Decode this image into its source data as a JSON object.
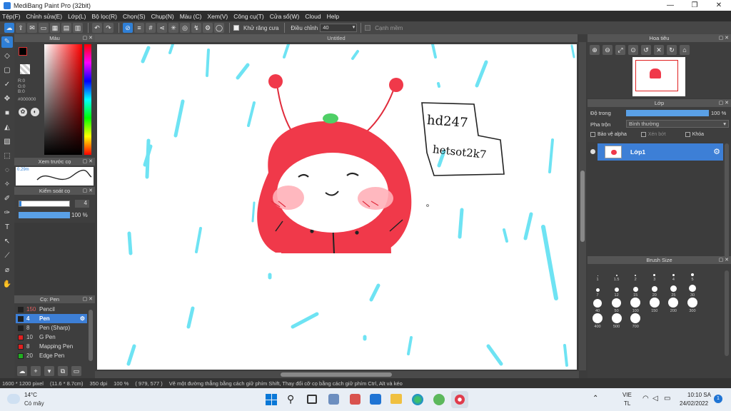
{
  "window": {
    "title": "MediBang Paint Pro (32bit)",
    "minimize": "—",
    "maximize": "❐",
    "close": "✕"
  },
  "menu": [
    "Tệp(F)",
    "Chỉnh sửa(E)",
    "Lớp(L)",
    "Bộ lọc(R)",
    "Chọn(S)",
    "Chụp(N)",
    "Màu (C)",
    "Xem(V)",
    "Công cụ(T)",
    "Cửa sổ(W)",
    "Cloud",
    "Help"
  ],
  "toolbar": {
    "antialias_label": "Khử răng cưa",
    "adjust_label": "Điều chỉnh",
    "adjust_value": "40",
    "smooth_label": "Cạnh mềm"
  },
  "color_panel": {
    "title": "Màu",
    "r": "R:0",
    "g": "G:0",
    "b": "B:0",
    "hex": "#000000"
  },
  "brush_preview": {
    "title": "Xem trước cọ",
    "size": "0.29m"
  },
  "brush_control": {
    "title": "Kiểm soát cọ",
    "size_value": "4",
    "opacity_value": "100 %"
  },
  "brush_list": {
    "title": "Cọ: Pen",
    "items": [
      {
        "size": "150",
        "name": "Pencil",
        "color": "#202020",
        "selected": false
      },
      {
        "size": "4",
        "name": "Pen",
        "color": "#202020",
        "selected": true
      },
      {
        "size": "8",
        "name": "Pen (Sharp)",
        "color": "#202020",
        "selected": false
      },
      {
        "size": "10",
        "name": "G Pen",
        "color": "#e02020",
        "selected": false
      },
      {
        "size": "8",
        "name": "Mapping Pen",
        "color": "#e02020",
        "selected": false
      },
      {
        "size": "20",
        "name": "Edge Pen",
        "color": "#20b020",
        "selected": false
      }
    ]
  },
  "document": {
    "tab": "Untitled"
  },
  "canvas_text": {
    "line1": "hd247",
    "line2": "hetsot2k7"
  },
  "navigator": {
    "title": "Hoa tiêu"
  },
  "layer_panel": {
    "title": "Lớp",
    "opacity_label": "Độ trong",
    "opacity_value": "100 %",
    "opacity_fraction": 1.0,
    "blend_label": "Pha trộn",
    "blend_value": "Bình thường",
    "protect_alpha": "Bảo vệ alpha",
    "clip": "Xén bớt",
    "lock": "Khóa",
    "layer_name": "Lớp1"
  },
  "brush_size": {
    "title": "Brush Size",
    "sizes": [
      "1",
      "1.5",
      "2",
      "3",
      "4",
      "5",
      "7",
      "12",
      "15",
      "20",
      "25",
      "30",
      "40",
      "50",
      "100",
      "150",
      "200",
      "300",
      "400",
      "500",
      "700"
    ]
  },
  "status": {
    "dimensions": "1600 * 1200 pixel",
    "physical": "(11.6 * 8.7cm)",
    "dpi": "350 dpi",
    "zoom": "100 %",
    "cursor": "( 979, 577 )",
    "hint": "Vẽ một đường thẳng bằng cách giữ phím Shift, Thay đổi cỡ cọ bằng cách giữ phím Ctrl, Alt và kéo"
  },
  "taskbar": {
    "weather_temp": "14°C",
    "weather_desc": "Có mây",
    "lang1": "VIE",
    "lang2": "TL",
    "time": "10:10 SA",
    "date": "24/02/2022",
    "notification_count": "1"
  },
  "colors": {
    "accent": "#2f7fd6",
    "character": "#f0394a",
    "rain": "#6ee3f3"
  }
}
